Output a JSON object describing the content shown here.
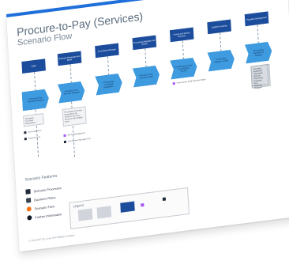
{
  "title": "Procure-to-Pay (Services)",
  "subtitle": "Scenario Flow",
  "lanes": [
    {
      "header": "Initial",
      "step": "Procure-to-Pay Services Request"
    },
    {
      "header": "Business Requester and Buyer",
      "step": "Procure to Pay Services Request"
    },
    {
      "header": "Purchasing Manager",
      "step": "Processing Purchase Requisition"
    },
    {
      "header": "Purchasing Manager and Vendor",
      "step": "Procure to Pay Services Order"
    },
    {
      "header": "Goods and Service Receiver",
      "step": "Confirming Service and Posting Invoice"
    },
    {
      "header": "Supplier Invoicing",
      "step": "Processing Supplier Invoice"
    },
    {
      "header": "Payables Management",
      "step": "Processing Payment to Supplier"
    }
  ],
  "notes": {
    "n1": "Managing Purchase Requisitions",
    "n2": "Accounting Fiori",
    "n3": "Trade Account",
    "n4": "Processing Purchase Requisitions for Services and Lean Services with Multiple Items",
    "n5": "Service Management",
    "n6": "Procurement Manager Fiori",
    "n7": "Procurement 2018 Warranty Dates",
    "doc": "Payment, Automatic Payments, Manual Payments, Payment Run, Payment Program"
  },
  "legend": {
    "title": "Scenario Features",
    "items": [
      {
        "label": "Scenario Processes",
        "icon": "dark-square-icon",
        "color": "#1f2937"
      },
      {
        "label": "Business Roles",
        "icon": "person-icon",
        "color": "#374151"
      },
      {
        "label": "Scenario Flow",
        "icon": "flow-icon",
        "color": "#f97316"
      },
      {
        "label": "Further Information",
        "icon": "info-icon",
        "color": "#111827"
      }
    ],
    "box_label": "Legend"
  },
  "footer": "© 2018 SAP SE or an SAP affiliate company"
}
